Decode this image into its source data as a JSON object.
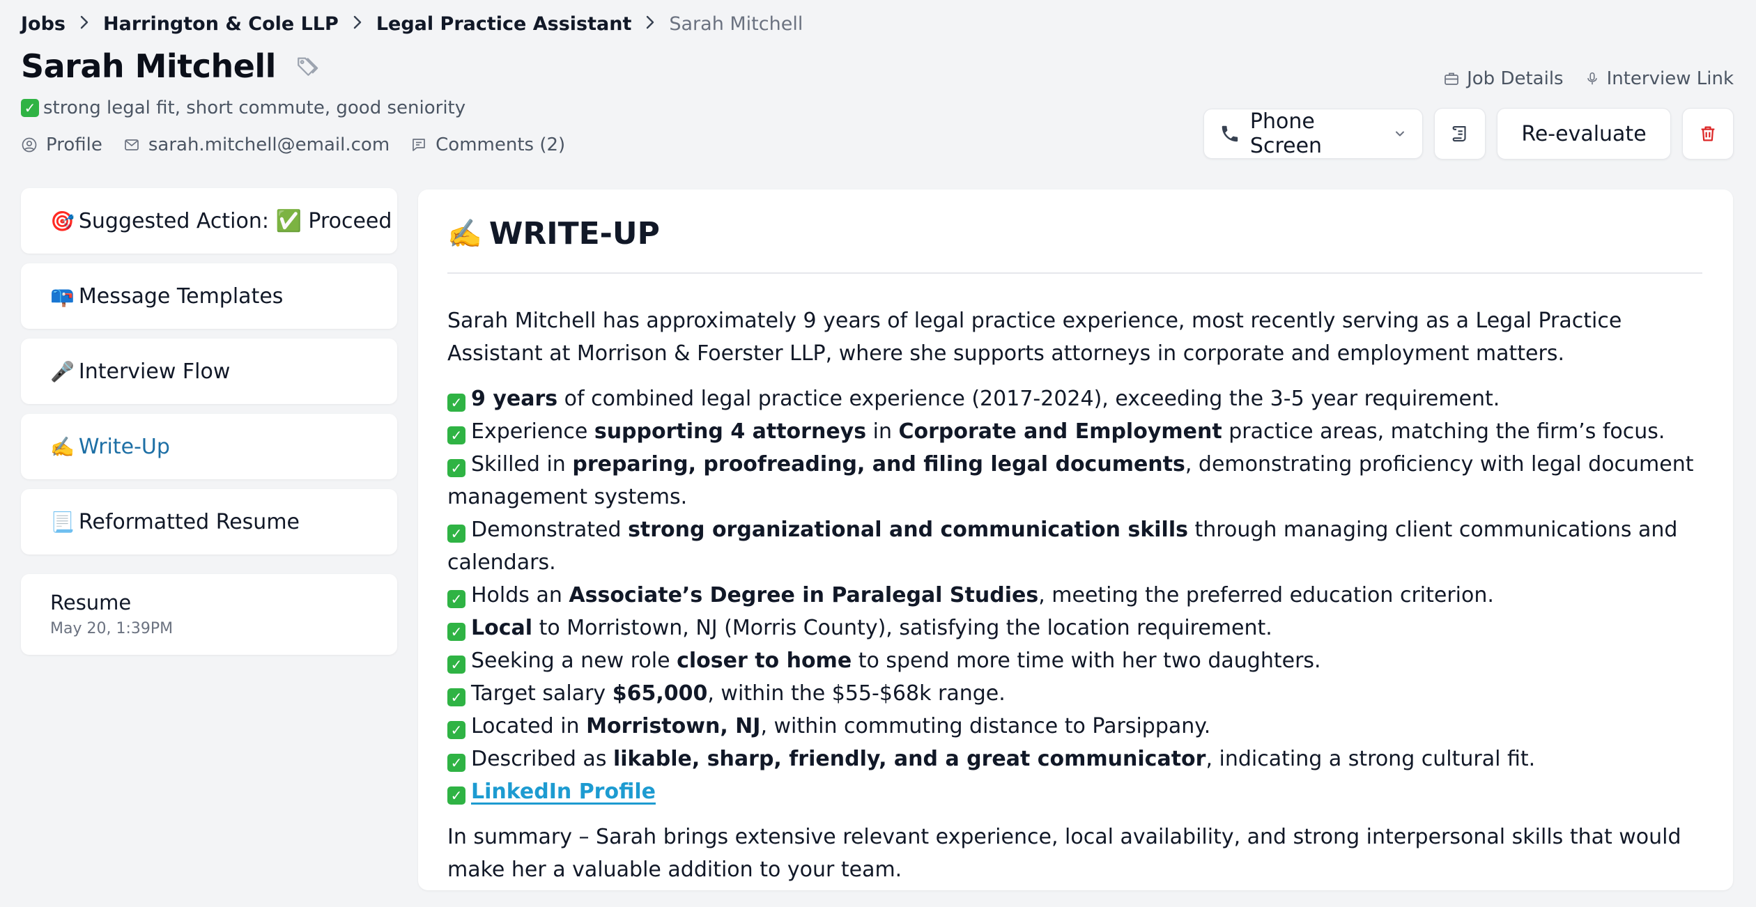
{
  "breadcrumb": {
    "items": [
      "Jobs",
      "Harrington & Cole LLP",
      "Legal Practice Assistant"
    ],
    "current": "Sarah Mitchell"
  },
  "candidate": {
    "name": "Sarah Mitchell",
    "tagline": "strong legal fit, short commute, good seniority",
    "profile_label": "Profile",
    "email": "sarah.mitchell@email.com",
    "comments_label": "Comments (2)"
  },
  "header_links": {
    "job_details": "Job Details",
    "interview_link": "Interview Link"
  },
  "actions": {
    "stage": "Phone Screen",
    "reevaluate": "Re-evaluate"
  },
  "sidebar": {
    "items": [
      {
        "emoji": "🎯",
        "label": "Suggested Action: ✅ Proceed"
      },
      {
        "emoji": "📪",
        "label": "Message Templates"
      },
      {
        "emoji": "🎤",
        "label": "Interview Flow"
      },
      {
        "emoji": "✍️",
        "label": "Write-Up"
      },
      {
        "emoji": "📃",
        "label": "Reformatted Resume"
      }
    ],
    "active_index": 3,
    "resume": {
      "title": "Resume",
      "date": "May 20, 1:39PM"
    }
  },
  "writeup": {
    "heading_emoji": "✍️",
    "heading": "WRITE-UP",
    "intro": "Sarah Mitchell has approximately 9 years of legal practice experience, most recently serving as a Legal Practice Assistant at Morrison & Foerster LLP, where she supports attorneys in corporate and employment matters.",
    "bullets": [
      {
        "b1": "9 years",
        "t1": " of combined legal practice experience (2017-2024), exceeding the 3-5 year requirement."
      },
      {
        "t0": "Experience ",
        "b1": "supporting 4 attorneys",
        "t1": " in ",
        "b2": "Corporate and Employment",
        "t2": " practice areas, matching the firm’s focus."
      },
      {
        "t0": "Skilled in ",
        "b1": "preparing, proofreading, and filing legal documents",
        "t1": ", demonstrating proficiency with legal document management systems."
      },
      {
        "t0": "Demonstrated ",
        "b1": "strong organizational and communication skills",
        "t1": " through managing client communications and calendars."
      },
      {
        "t0": "Holds an ",
        "b1": "Associate’s Degree in Paralegal Studies",
        "t1": ", meeting the preferred education criterion."
      },
      {
        "b1": "Local",
        "t1": " to Morristown, NJ (Morris County), satisfying the location requirement."
      },
      {
        "t0": "Seeking a new role ",
        "b1": "closer to home",
        "t1": " to spend more time with her two daughters."
      },
      {
        "t0": "Target salary ",
        "b1": "$65,000",
        "t1": ", within the $55-$68k range."
      },
      {
        "t0": "Located in ",
        "b1": "Morristown, NJ",
        "t1": ", within commuting distance to Parsippany."
      },
      {
        "t0": "Described as ",
        "b1": "likable, sharp, friendly, and a great communicator",
        "t1": ", indicating a strong cultural fit."
      }
    ],
    "linkedin_label": "LinkedIn Profile",
    "summary": "In summary – Sarah brings extensive relevant experience, local availability, and strong interpersonal skills that would make her a valuable addition to your team."
  },
  "colors": {
    "accent": "#1d6fa5",
    "link": "#1d9bd1",
    "check": "#2fb344",
    "delete": "#dc2626",
    "background": "#f3f4f6"
  }
}
